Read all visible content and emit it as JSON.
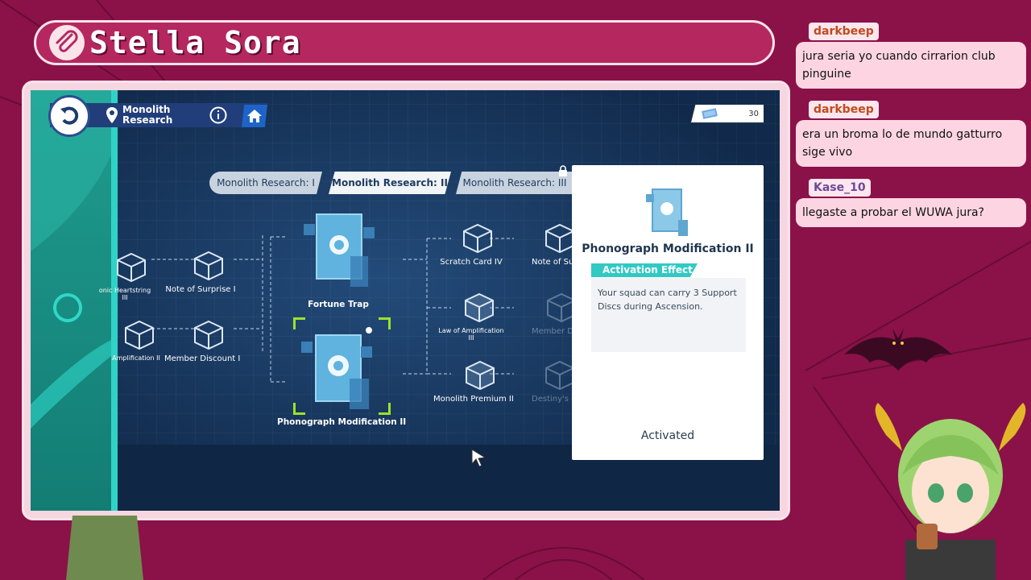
{
  "stream": {
    "title": "Stella Sora"
  },
  "game": {
    "location_label": "Monolith\nResearch",
    "currency_value": "30",
    "tabs": [
      {
        "label": "Monolith Research: I"
      },
      {
        "label": "Monolith Research: II"
      },
      {
        "label": "Monolith Research: III"
      }
    ],
    "nodes": {
      "n1": "onic Heartstring\nIII",
      "n2": "Note of Surprise I",
      "n3": "Amplification II",
      "n4": "Member Discount I",
      "fortune_trap": "Fortune Trap",
      "phonograph": "Phonograph Modification II",
      "scratch_card": "Scratch Card IV",
      "note_surp": "Note of Surp",
      "law_amp": "Law of Amplification\nIII",
      "member_disc": "Member Disc",
      "monolith_premium": "Monolith Premium II",
      "destinys": "Destiny's Ch"
    },
    "panel": {
      "title": "Phonograph Modification II",
      "effect_label": "Activation Effect",
      "effect_text": "Your squad can carry 3 Support Discs during Ascension.",
      "status": "Activated"
    }
  },
  "chat": [
    {
      "user": "darkbeep",
      "message": "jura seria yo cuando cirrarion club pinguine"
    },
    {
      "user": "darkbeep",
      "message": "era un broma lo de mundo gatturro sige vivo"
    },
    {
      "user": "Kase_10",
      "message": "llegaste a probar el WUWA jura?"
    }
  ],
  "colors": {
    "background": "#8a1248",
    "accent_teal": "#31c9c4",
    "select_green": "#9be22a"
  }
}
